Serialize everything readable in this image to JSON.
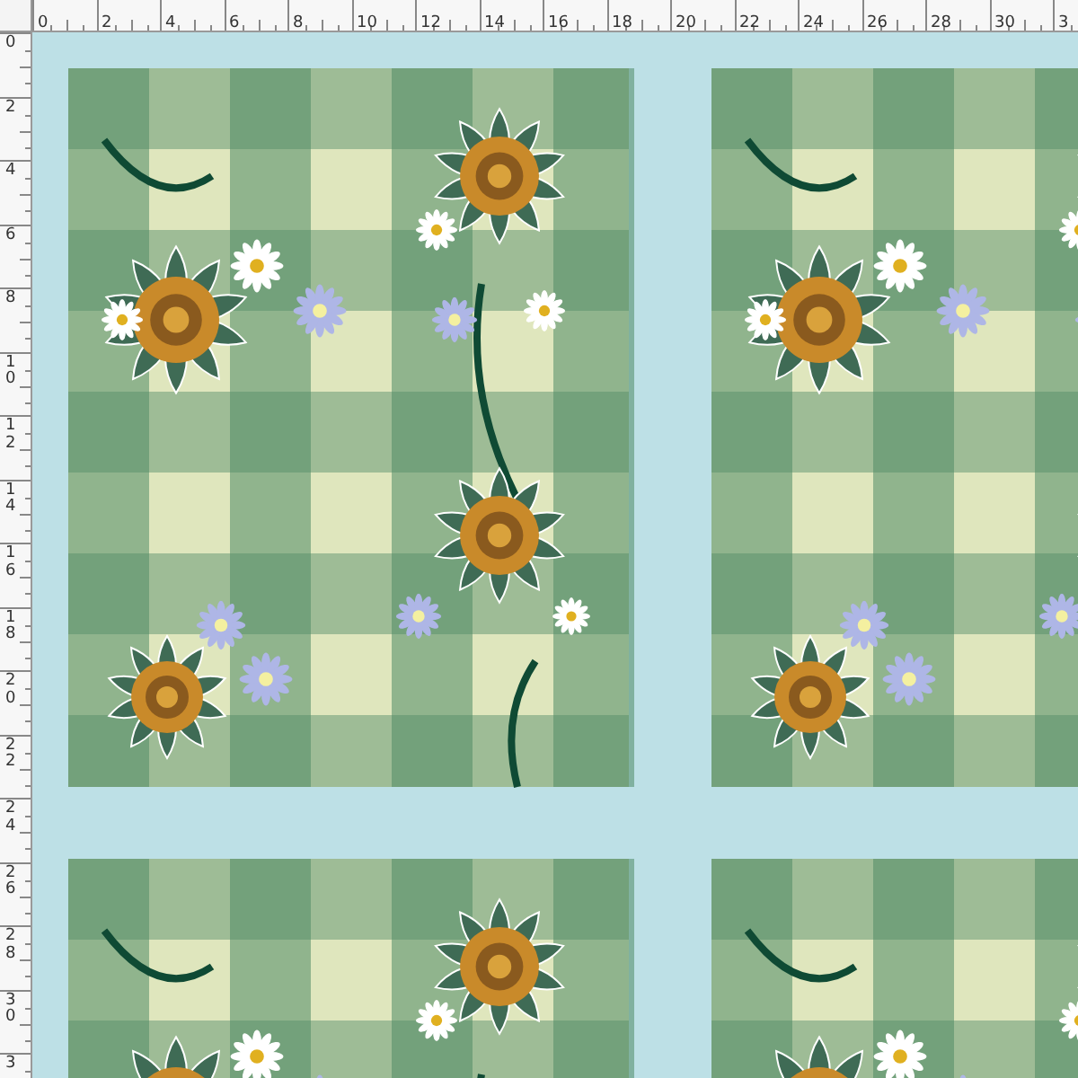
{
  "rulers": {
    "horizontal": [
      "0",
      "2",
      "4",
      "6",
      "8",
      "10",
      "12",
      "14",
      "16",
      "18",
      "20",
      "22",
      "24",
      "26",
      "28",
      "30",
      "3"
    ],
    "vertical": [
      "0",
      "2",
      "4",
      "6",
      "8",
      "10",
      "12",
      "14",
      "16",
      "18",
      "20",
      "22",
      "24",
      "26",
      "28",
      "30",
      "3"
    ]
  }
}
